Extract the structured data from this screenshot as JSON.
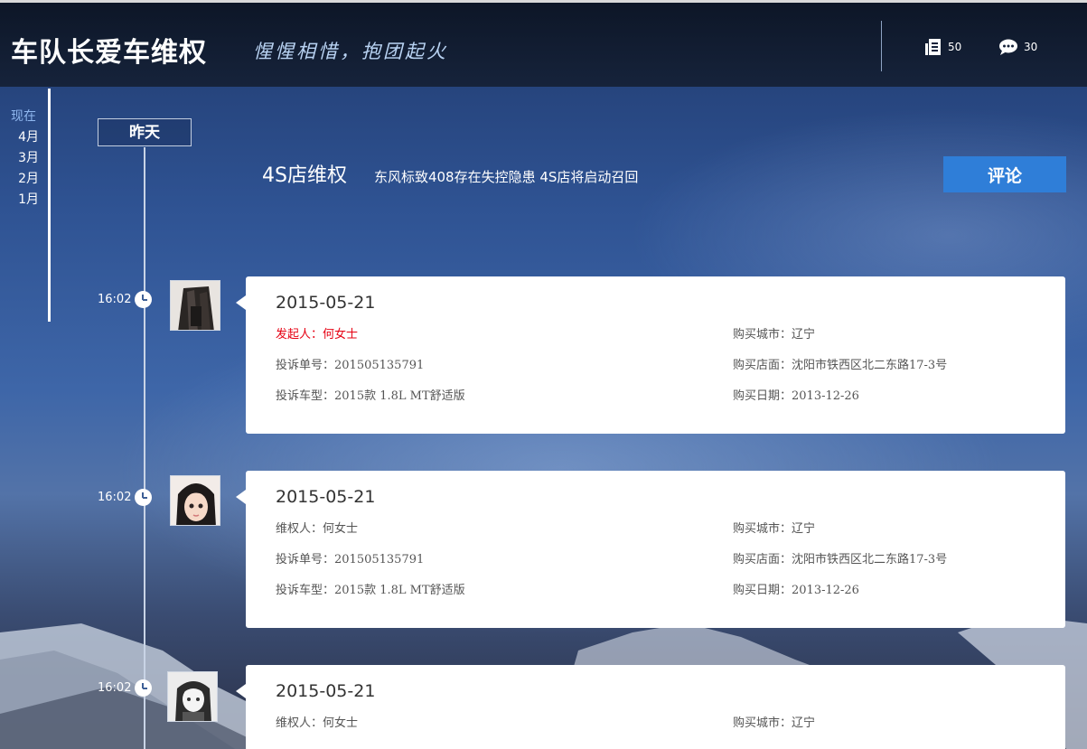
{
  "header": {
    "brand": "车队长爱车维权",
    "slogan": "惺惺相惜，抱团起火",
    "docs_count": "50",
    "comments_count": "30",
    "icons": [
      "document-icon",
      "chat-bubble-icon"
    ]
  },
  "month_nav": {
    "items": [
      "现在",
      "4月",
      "3月",
      "2月",
      "1月"
    ],
    "active_index": 0
  },
  "timeline": {
    "day_label": "昨天"
  },
  "headline": {
    "category": "4S店维权",
    "news": "东风标致408存在失控隐患  4S店将启动召回",
    "comment_button": "评论"
  },
  "entries": [
    {
      "time": "16:02",
      "date": "2015-05-21",
      "person": "发起人：何女士",
      "complaint_no": "投诉单号：201505135791",
      "car_model": "投诉车型：2015款 1.8L MT舒适版",
      "city": "购买城市：辽宁",
      "store": "购买店面：沈阳市铁西区北二东路17-3号",
      "purchase_date": "购买日期：2013-12-26"
    },
    {
      "time": "16:02",
      "date": "2015-05-21",
      "person": "维权人：何女士",
      "complaint_no": "投诉单号：201505135791",
      "car_model": "投诉车型：2015款 1.8L MT舒适版",
      "city": "购买城市：辽宁",
      "store": "购买店面：沈阳市铁西区北二东路17-3号",
      "purchase_date": "购买日期：2013-12-26"
    },
    {
      "time": "16:02",
      "date": "2015-05-21",
      "person": "维权人：何女士",
      "city": "购买城市：辽宁"
    }
  ],
  "colors": {
    "accent": "#2f7ed8",
    "initiator": "#e60012",
    "header_bg": "#0d1627"
  }
}
